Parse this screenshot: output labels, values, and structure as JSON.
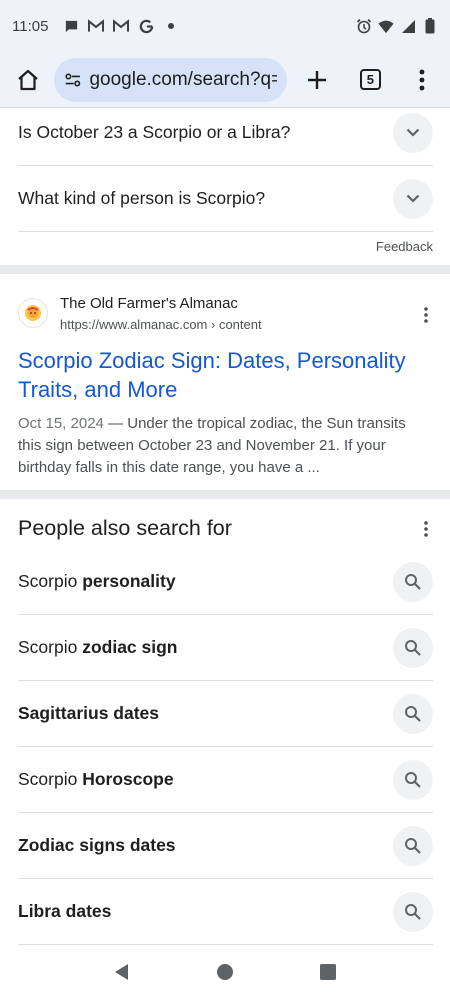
{
  "status_bar": {
    "time": "11:05",
    "left_icons": [
      "chat-icon",
      "gmail-icon",
      "gmail-icon",
      "google-icon",
      "dot-icon"
    ],
    "right_icons": [
      "alarm-icon",
      "wifi-icon",
      "signal-icon",
      "battery-icon"
    ]
  },
  "toolbar": {
    "url": "google.com/search?q=sc",
    "tab_count": "5"
  },
  "faq": {
    "items": [
      {
        "question": "Is October 23 a Scorpio or a Libra?"
      },
      {
        "question": "What kind of person is Scorpio?"
      }
    ],
    "feedback_label": "Feedback"
  },
  "result": {
    "site_name": "The Old Farmer's Almanac",
    "site_url": "https://www.almanac.com",
    "site_url_path": " › content",
    "title": "Scorpio Zodiac Sign: Dates, Personality Traits, and More",
    "snippet_date": "Oct 15, 2024",
    "snippet_text": " — Under the tropical zodiac, the Sun transits this sign between October 23 and November 21. If your birthday falls in this date range, you have a ..."
  },
  "people_also_search": {
    "title": "People also search for",
    "items": [
      {
        "plain": "Scorpio ",
        "bold": "personality"
      },
      {
        "plain": "Scorpio ",
        "bold": "zodiac sign"
      },
      {
        "plain": "",
        "bold": "Sagittarius dates"
      },
      {
        "plain": "Scorpio ",
        "bold": "Horoscope"
      },
      {
        "plain": "",
        "bold": "Zodiac signs dates"
      },
      {
        "plain": "",
        "bold": "Libra dates"
      }
    ]
  },
  "colors": {
    "link": "#1558d6",
    "chrome_bg": "#eef2f9",
    "url_pill": "#d6e2f7"
  }
}
